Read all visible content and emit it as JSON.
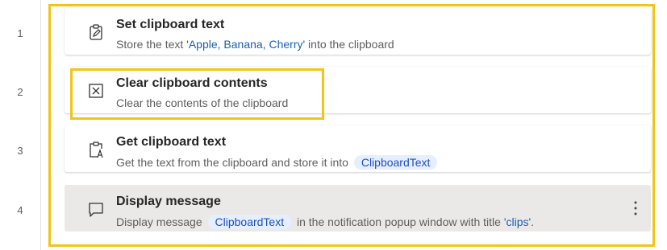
{
  "steps": [
    {
      "line": "1",
      "icon": "clipboard-edit-icon",
      "title": "Set clipboard text",
      "desc_prefix": "Store the text ",
      "desc_value": "'Apple, Banana, Cherry'",
      "desc_suffix": " into the clipboard"
    },
    {
      "line": "2",
      "icon": "clear-box-icon",
      "title": "Clear clipboard contents",
      "desc": "Clear the contents of the clipboard"
    },
    {
      "line": "3",
      "icon": "clipboard-text-icon",
      "title": "Get clipboard text",
      "desc_prefix": "Get the text from the clipboard and store it into ",
      "desc_variable": "ClipboardText"
    },
    {
      "line": "4",
      "icon": "message-icon",
      "title": "Display message",
      "desc_prefix": "Display message ",
      "desc_variable": "ClipboardText",
      "desc_middle": " in the notification popup window with title ",
      "desc_value": "'clips'",
      "desc_suffix": ".",
      "more_icon": "more-vertical-icon"
    }
  ],
  "colors": {
    "highlight": "#f2c417",
    "selected_bg": "#ebe9e7",
    "variable_bg": "#e6efff",
    "value_text": "#1a5fb4"
  }
}
